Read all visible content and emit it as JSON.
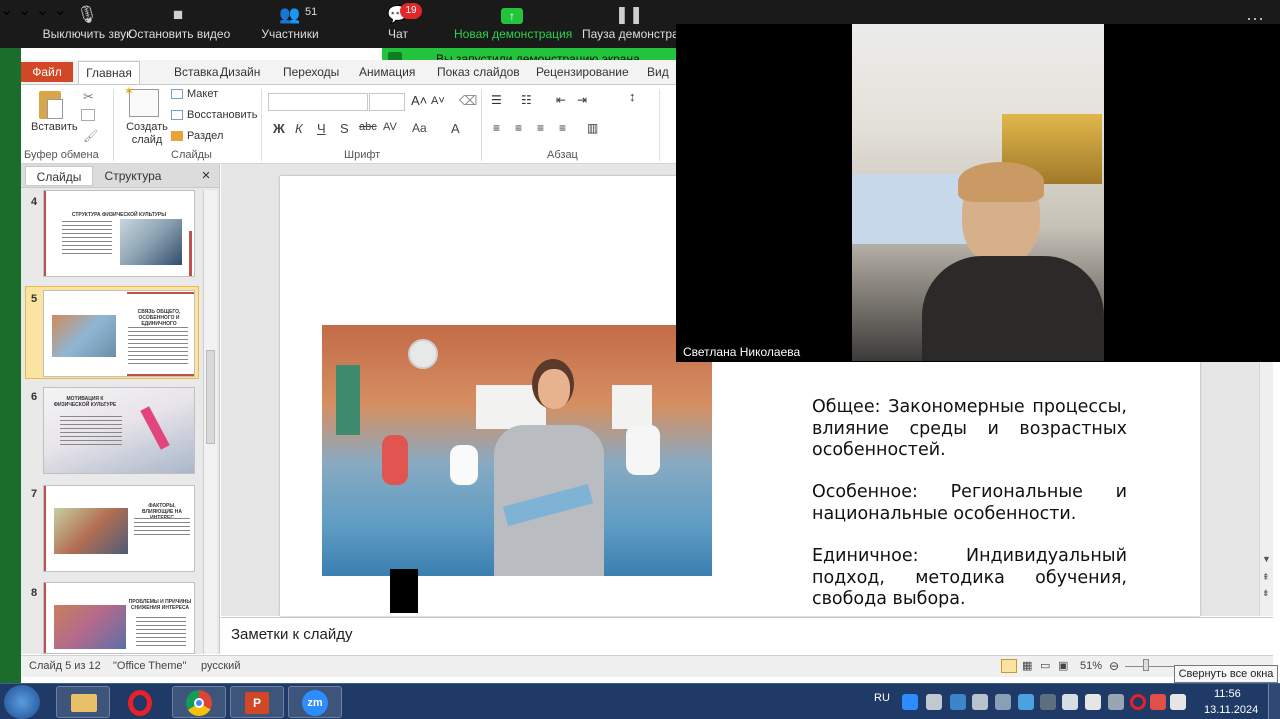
{
  "zoom_toolbar": {
    "mute_label": "Выключить звук",
    "video_label": "Остановить видео",
    "participants_label": "Участники",
    "participants_count": "51",
    "chat_label": "Чат",
    "chat_badge": "19",
    "new_share_label": "Новая демонстрация",
    "pause_share_label": "Пауза демонстрации",
    "share_banner": "Вы запустили демонстрацию экрана"
  },
  "ribbon": {
    "file_tab": "Файл",
    "tabs": [
      "Главная",
      "Вставка",
      "Дизайн",
      "Переходы",
      "Анимация",
      "Показ слайдов",
      "Рецензирование",
      "Вид"
    ],
    "paste_label": "Вставить",
    "new_slide_label": "Создать слайд",
    "layout_label": "Макет",
    "reset_label": "Восстановить",
    "section_label": "Раздел",
    "group_clipboard": "Буфер обмена",
    "group_slides": "Слайды",
    "group_font": "Шрифт",
    "group_paragraph": "Абзац",
    "font_buttons": [
      "Ж",
      "К",
      "Ч",
      "S",
      "abc",
      "AV",
      "Aa",
      "A"
    ]
  },
  "slide_panel": {
    "tab_slides": "Слайды",
    "tab_outline": "Структура",
    "close": "×",
    "thumbs": [
      {
        "num": "4",
        "title": "СТРУКТУРА ФИЗИЧЕСКОЙ КУЛЬТУРЫ"
      },
      {
        "num": "5",
        "title": "СВЯЗЬ ОБЩЕГО, ОСОБЕННОГО И ЕДИНИЧНОГО"
      },
      {
        "num": "6",
        "title": "МОТИВАЦИЯ К ФИЗИЧЕСКОЙ КУЛЬТУРЕ"
      },
      {
        "num": "7",
        "title": "ФАКТОРЫ, ВЛИЯЮЩИЕ НА ИНТЕРЕС"
      },
      {
        "num": "8",
        "title": "ПРОБЛЕМЫ И ПРИЧИНЫ СНИЖЕНИЯ ИНТЕРЕСА"
      }
    ]
  },
  "slide": {
    "p1": "Общее: Закономерные процессы, влияние среды и возрастных особенностей.",
    "p2": "Особенное: Региональные и национальные особенности.",
    "p3": "Единичное: Индивидуальный подход, методика обучения, свобода выбора."
  },
  "notes_placeholder": "Заметки к слайду",
  "status": {
    "slide_counter": "Слайд 5 из 12",
    "theme": "\"Office Theme\"",
    "language": "русский",
    "zoom": "51%"
  },
  "video": {
    "speaker_name": "Светлана Николаева"
  },
  "tooltip": "Свернуть все окна",
  "taskbar": {
    "lang": "RU",
    "time": "11:56",
    "date": "13.11.2024",
    "zoom_app_label": "zm"
  },
  "colors": {
    "accent_file": "#d24726",
    "share_green": "#23c33b",
    "taskbar": "#1f3a66",
    "slide_accent": "#c0504d"
  }
}
